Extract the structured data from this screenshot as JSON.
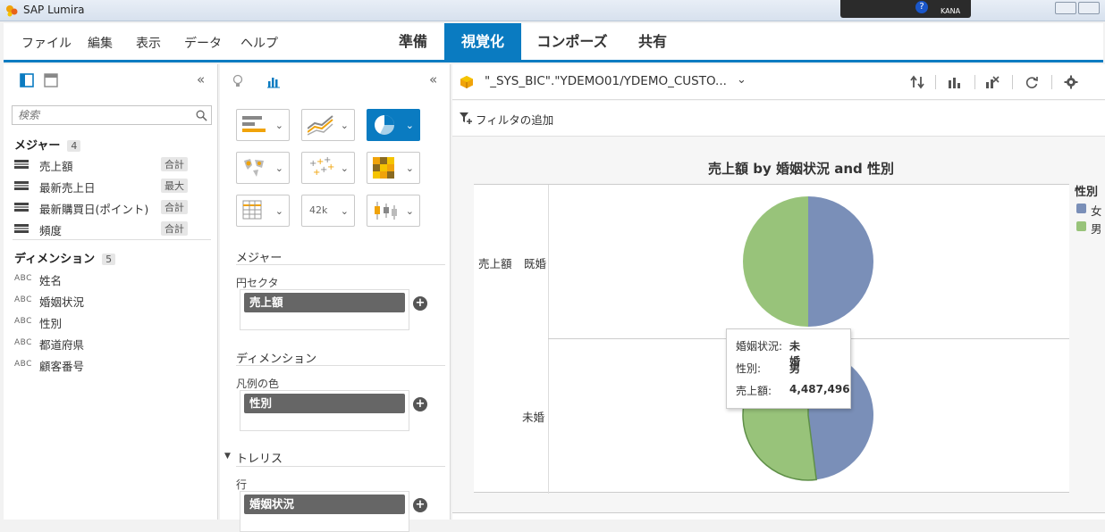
{
  "window": {
    "title": "SAP Lumira",
    "ime_mode": "KANA"
  },
  "menu": {
    "items": [
      "ファイル",
      "編集",
      "表示",
      "データ",
      "ヘルプ"
    ],
    "modes": [
      "準備",
      "視覚化",
      "コンポーズ",
      "共有"
    ],
    "active_mode": "視覚化"
  },
  "data_panel": {
    "search_placeholder": "検索",
    "measures": {
      "title": "メジャー",
      "count": "4",
      "items": [
        {
          "label": "売上額",
          "agg": "合計"
        },
        {
          "label": "最新売上日",
          "agg": "最大"
        },
        {
          "label": "最新購買日(ポイント)",
          "agg": "合計"
        },
        {
          "label": "頻度",
          "agg": "合計"
        }
      ]
    },
    "dimensions": {
      "title": "ディメンション",
      "count": "5",
      "type_tag": "ABC",
      "items": [
        "姓名",
        "婚姻状況",
        "性別",
        "都道府県",
        "顧客番号"
      ]
    }
  },
  "builder_panel": {
    "measures_title": "メジャー",
    "pie_sector_label": "円セクタ",
    "pie_sector_value": "売上額",
    "dimensions_title": "ディメンション",
    "legend_color_label": "凡例の色",
    "legend_color_value": "性別",
    "trellis_title": "トレリス",
    "row_label": "行",
    "row_value": "婚姻状況",
    "number_icon_text": "42k"
  },
  "viz_panel": {
    "datasource": "\"_SYS_BIC\".\"YDEMO01/YDEMO_CUSTO...",
    "filter_label": "フィルタの追加"
  },
  "colors": {
    "accent": "#0a7bc1",
    "female": "#7a8fb8",
    "male": "#98c37a"
  },
  "chart_data": {
    "type": "pie",
    "title": "売上額 by 婚姻状況 and 性別",
    "measure_label": "売上額",
    "trellis_rows": [
      {
        "label": "既婚",
        "slices": [
          {
            "name": "女",
            "value": 50
          },
          {
            "name": "男",
            "value": 50
          }
        ]
      },
      {
        "label": "未婚",
        "slices": [
          {
            "name": "女",
            "value": 48
          },
          {
            "name": "男",
            "value": 52
          }
        ]
      }
    ],
    "legend": {
      "title": "性別",
      "placement": "right",
      "entries": [
        "女",
        "男"
      ]
    }
  },
  "tooltip": {
    "rows": [
      {
        "key": "婚姻状況:",
        "value": "未婚"
      },
      {
        "key": "性別:",
        "value": "男"
      },
      {
        "key": "売上額:",
        "value": "4,487,496"
      }
    ]
  }
}
